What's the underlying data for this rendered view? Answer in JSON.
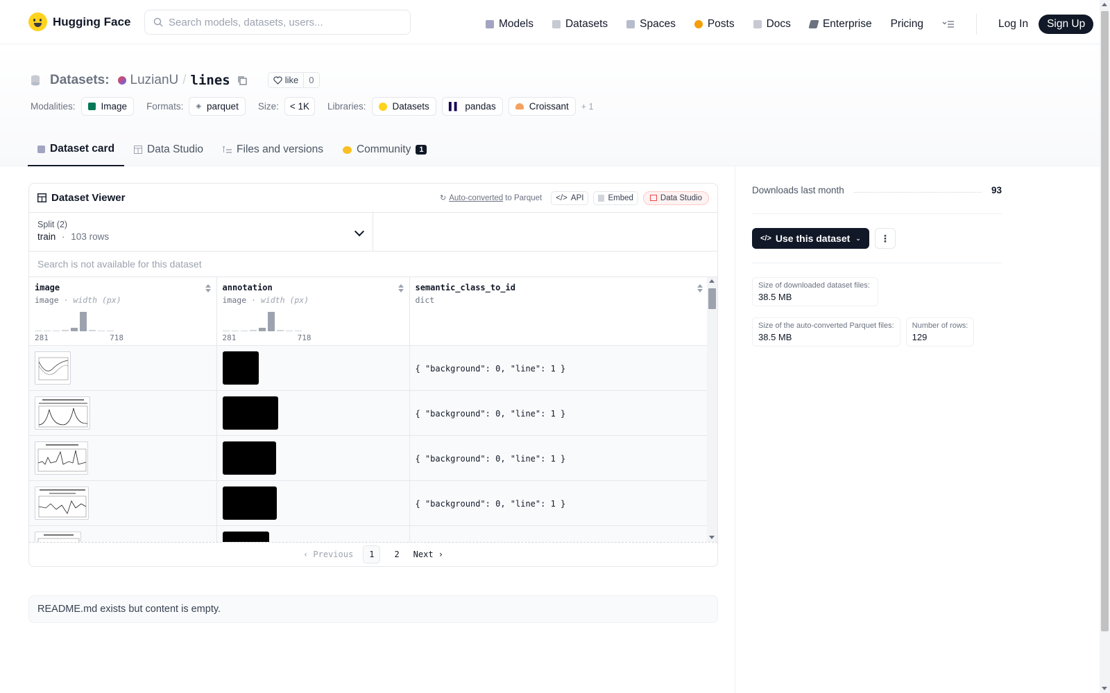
{
  "header": {
    "logo_text": "Hugging Face",
    "search_placeholder": "Search models, datasets, users...",
    "nav": [
      {
        "label": "Models",
        "icon": "models-icon",
        "color": "#a3a3c2"
      },
      {
        "label": "Datasets",
        "icon": "datasets-icon",
        "color": "#c7c9d3"
      },
      {
        "label": "Spaces",
        "icon": "spaces-icon",
        "color": "#b6bccb"
      },
      {
        "label": "Posts",
        "icon": "posts-icon",
        "color": "#f59e0b"
      },
      {
        "label": "Docs",
        "icon": "docs-icon",
        "color": "#c7c9d3"
      },
      {
        "label": "Enterprise",
        "icon": "enterprise-icon",
        "color": "#6b7280"
      },
      {
        "label": "Pricing",
        "icon": "",
        "color": ""
      }
    ],
    "login": "Log In",
    "signup": "Sign Up"
  },
  "dataset": {
    "prefix": "Datasets:",
    "owner": "LuzianU",
    "separator": "/",
    "name": "lines",
    "like_label": "like",
    "like_count": "0",
    "tags": {
      "modalities_label": "Modalities:",
      "modality": "Image",
      "formats_label": "Formats:",
      "format": "parquet",
      "size_label": "Size:",
      "size": "< 1K",
      "libraries_label": "Libraries:",
      "libraries": [
        "Datasets",
        "pandas",
        "Croissant"
      ],
      "more": "+ 1"
    },
    "tabs": [
      {
        "label": "Dataset card",
        "active": true
      },
      {
        "label": "Data Studio",
        "active": false
      },
      {
        "label": "Files and versions",
        "active": false
      },
      {
        "label": "Community",
        "active": false,
        "badge": "1"
      }
    ]
  },
  "viewer": {
    "title": "Dataset Viewer",
    "auto_converted": "Auto-converted",
    "to_parquet": "to Parquet",
    "api": "API",
    "embed": "Embed",
    "data_studio": "Data Studio",
    "split_label": "Split (2)",
    "split_value": "train",
    "split_dot": "·",
    "split_rows": "103 rows",
    "search_disabled": "Search is not available for this dataset",
    "columns": [
      {
        "name": "image",
        "type": "image",
        "subtype": "· width (px)",
        "min": "281",
        "max": "718",
        "hist": [
          0.05,
          0,
          0,
          0.06,
          0.18,
          1.0,
          0.06,
          0.05,
          0.05
        ]
      },
      {
        "name": "annotation",
        "type": "image",
        "subtype": "· width (px)",
        "min": "281",
        "max": "718",
        "hist": [
          0.05,
          0,
          0,
          0.06,
          0.18,
          1.0,
          0.06,
          0.05,
          0.05
        ]
      },
      {
        "name": "semantic_class_to_id",
        "type": "dict",
        "subtype": "",
        "min": "",
        "max": "",
        "hist": []
      }
    ],
    "rows": [
      {
        "dict": "{ \"background\": 0, \"line\": 1 }"
      },
      {
        "dict": "{ \"background\": 0, \"line\": 1 }"
      },
      {
        "dict": "{ \"background\": 0, \"line\": 1 }"
      },
      {
        "dict": "{ \"background\": 0, \"line\": 1 }"
      },
      {
        "dict": ""
      }
    ],
    "pager": {
      "previous": "Previous",
      "pages": [
        "1",
        "2"
      ],
      "current": "1",
      "next": "Next"
    }
  },
  "readme_note": "README.md exists but content is empty.",
  "sidebar": {
    "downloads_label": "Downloads last month",
    "downloads_value": "93",
    "use_button": "Use this dataset",
    "stats": [
      {
        "label": "Size of downloaded dataset files:",
        "value": "38.5 MB"
      },
      {
        "label": "Size of the auto-converted Parquet files:",
        "value": "38.5 MB"
      },
      {
        "label": "Number of rows:",
        "value": "129"
      }
    ]
  }
}
